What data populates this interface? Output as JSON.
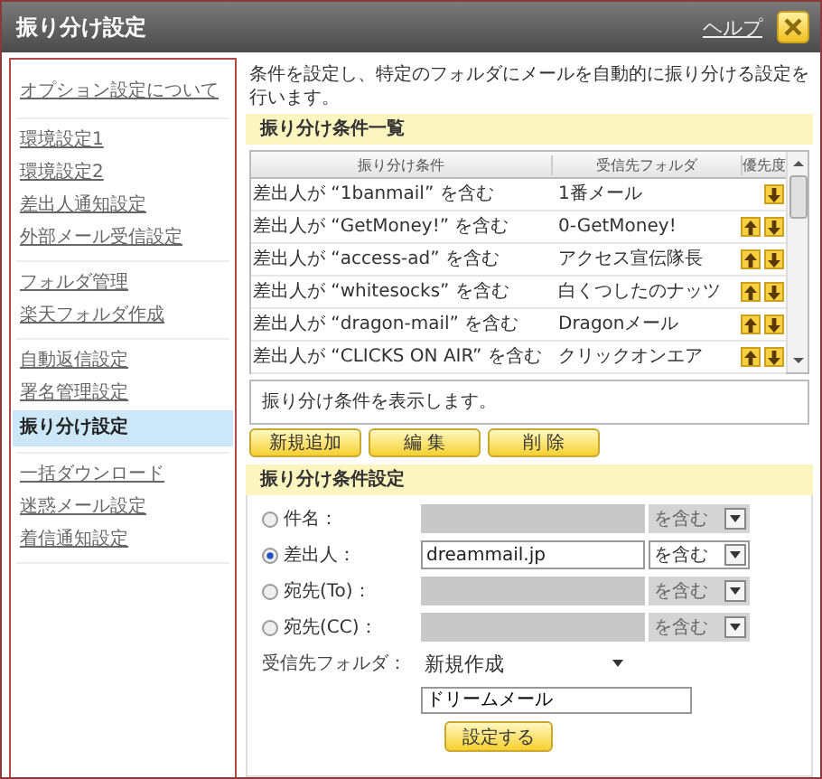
{
  "window": {
    "title": "振り分け設定",
    "help_link": "ヘルプ"
  },
  "sidebar": {
    "groups": [
      {
        "items": [
          {
            "label": "オプション設定について",
            "selected": false
          }
        ]
      },
      {
        "items": [
          {
            "label": "環境設定1",
            "selected": false
          },
          {
            "label": "環境設定2",
            "selected": false
          },
          {
            "label": "差出人通知設定",
            "selected": false
          },
          {
            "label": "外部メール受信設定",
            "selected": false
          }
        ]
      },
      {
        "items": [
          {
            "label": "フォルダ管理",
            "selected": false
          },
          {
            "label": "楽天フォルダ作成",
            "selected": false
          }
        ]
      },
      {
        "items": [
          {
            "label": "自動返信設定",
            "selected": false
          },
          {
            "label": "署名管理設定",
            "selected": false
          },
          {
            "label": "振り分け設定",
            "selected": true
          }
        ]
      },
      {
        "items": [
          {
            "label": "一括ダウンロード",
            "selected": false
          },
          {
            "label": "迷惑メール設定",
            "selected": false
          },
          {
            "label": "着信通知設定",
            "selected": false
          }
        ]
      }
    ]
  },
  "description": "条件を設定し、特定のフォルダにメールを自動的に振り分ける設定を行います。",
  "rule_list": {
    "heading": "振り分け条件一覧",
    "columns": [
      "振り分け条件",
      "受信先フォルダ",
      "優先度"
    ],
    "rows": [
      {
        "condition": "差出人が “1banmail” を含む",
        "folder": "1番メール",
        "can_move_up": false
      },
      {
        "condition": "差出人が “GetMoney!” を含む",
        "folder": "0-GetMoney!",
        "can_move_up": true
      },
      {
        "condition": "差出人が “access-ad” を含む",
        "folder": "アクセス宣伝隊長",
        "can_move_up": true
      },
      {
        "condition": "差出人が “whitesocks” を含む",
        "folder": "白くつしたのナッツ",
        "can_move_up": true
      },
      {
        "condition": "差出人が “dragon-mail” を含む",
        "folder": "Dragonメール",
        "can_move_up": true
      },
      {
        "condition": "差出人が “CLICKS ON AIR” を含む",
        "folder": "クリックオンエア",
        "can_move_up": true
      }
    ],
    "message": "振り分け条件を表示します。",
    "buttons": [
      "新規追加",
      "編 集",
      "削 除"
    ]
  },
  "rule_form": {
    "heading": "振り分け条件設定",
    "fields": [
      {
        "label": "件名：",
        "selected": false,
        "match": "を含む"
      },
      {
        "label": "差出人：",
        "selected": true,
        "value": "dreammail.jp",
        "match": "を含む"
      },
      {
        "label": "宛先(To)：",
        "selected": false,
        "match": "を含む"
      },
      {
        "label": "宛先(CC)：",
        "selected": false,
        "match": "を含む"
      }
    ],
    "folder_label": "受信先フォルダ：",
    "folder_choice": "新規作成",
    "new_folder_name": "ドリームメール",
    "submit": "設定する"
  }
}
